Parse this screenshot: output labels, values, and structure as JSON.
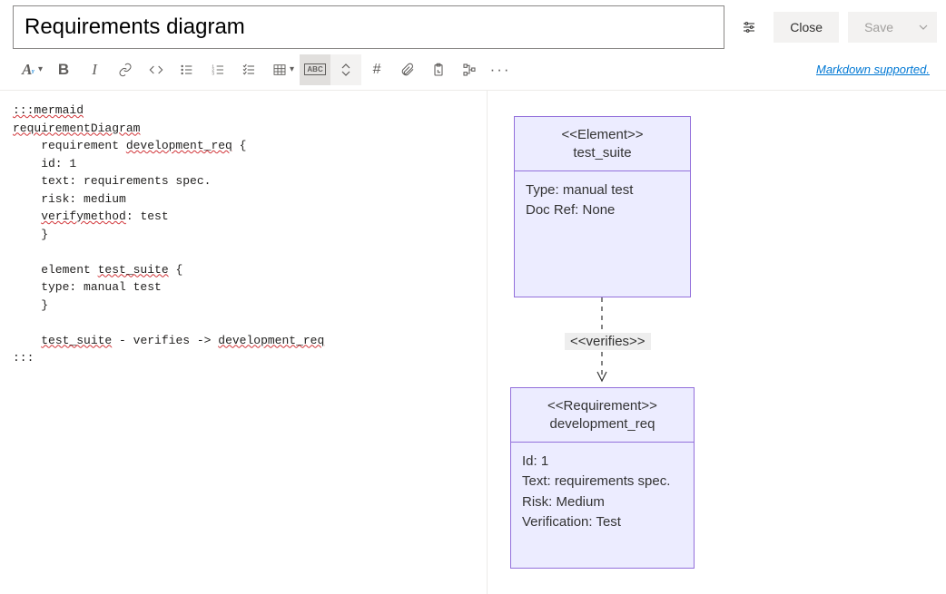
{
  "header": {
    "title_value": "Requirements diagram",
    "close_label": "Close",
    "save_label": "Save"
  },
  "toolbar": {
    "markdown_support": "Markdown supported.",
    "bold": "B",
    "italic": "I",
    "hash": "#",
    "highlight": "ABC",
    "more": "···"
  },
  "editor": {
    "lines": [
      ":::mermaid",
      "requirementDiagram",
      "    requirement development_req {",
      "    id: 1",
      "    text: requirements spec.",
      "    risk: medium",
      "    verifymethod: test",
      "    }",
      "",
      "    element test_suite {",
      "    type: manual test",
      "    }",
      "",
      "    test_suite - verifies -> development_req",
      ":::"
    ]
  },
  "diagram": {
    "element": {
      "stereotype": "<<Element>>",
      "name": "test_suite",
      "type_line": "Type: manual test",
      "docref_line": "Doc Ref: None"
    },
    "relationship": {
      "label": "<<verifies>>"
    },
    "requirement": {
      "stereotype": "<<Requirement>>",
      "name": "development_req",
      "id_line": "Id: 1",
      "text_line": "Text: requirements spec.",
      "risk_line": "Risk: Medium",
      "verify_line": "Verification: Test"
    }
  }
}
